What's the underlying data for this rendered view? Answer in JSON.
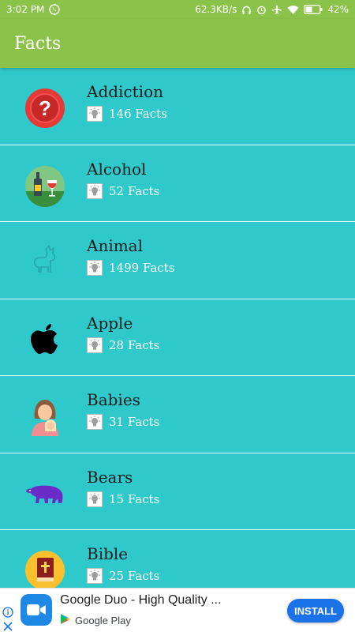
{
  "status_bar": {
    "time": "3:02 PM",
    "network_speed": "62.3KB/s",
    "battery": "42%",
    "icons": [
      "whatsapp-icon",
      "headphones-icon",
      "alarm-icon",
      "airplane-icon",
      "wifi-icon",
      "battery-icon"
    ]
  },
  "app_bar": {
    "title": "Facts"
  },
  "categories": [
    {
      "name": "Addiction",
      "count": "146 Facts",
      "icon": "question-mark-icon"
    },
    {
      "name": "Alcohol",
      "count": "52 Facts",
      "icon": "wine-bottle-icon"
    },
    {
      "name": "Animal",
      "count": "1499 Facts",
      "icon": "llama-icon"
    },
    {
      "name": "Apple",
      "count": "28 Facts",
      "icon": "apple-logo-icon"
    },
    {
      "name": "Babies",
      "count": "31 Facts",
      "icon": "mother-baby-icon"
    },
    {
      "name": "Bears",
      "count": "15 Facts",
      "icon": "bear-icon"
    },
    {
      "name": "Bible",
      "count": "25 Facts",
      "icon": "bible-icon"
    }
  ],
  "ad": {
    "title": "Google Duo - High Quality ...",
    "store": "Google Play",
    "install_label": "INSTALL",
    "app_icon": "video-camera-icon"
  },
  "colors": {
    "app_bar": "#8bc34a",
    "list_background": "#2fc9cc",
    "install_button": "#1a73e8"
  }
}
